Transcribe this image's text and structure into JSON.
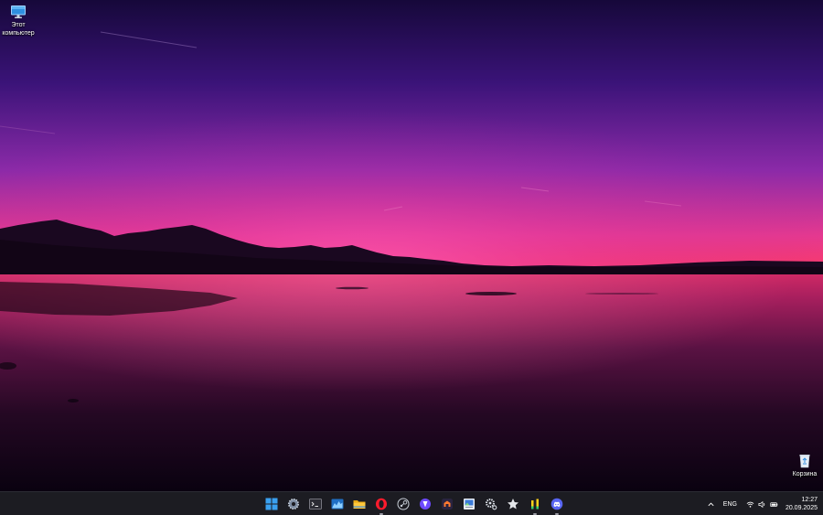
{
  "desktop": {
    "icons": [
      {
        "label": "Этот компьютер",
        "icon": "monitor-icon"
      },
      {
        "label": "Корзина",
        "icon": "recycle-bin-icon"
      }
    ]
  },
  "taskbar": {
    "apps": [
      {
        "name": "Start",
        "icon": "windows-start-icon",
        "running": false
      },
      {
        "name": "Settings",
        "icon": "settings-gear-icon",
        "running": false
      },
      {
        "name": "Terminal",
        "icon": "terminal-icon",
        "running": false
      },
      {
        "name": "Task Manager",
        "icon": "task-manager-icon",
        "running": false
      },
      {
        "name": "File Explorer",
        "icon": "folder-icon",
        "running": false
      },
      {
        "name": "Opera",
        "icon": "opera-icon",
        "running": true
      },
      {
        "name": "Steam",
        "icon": "steam-icon",
        "running": false
      },
      {
        "name": "Proton VPN",
        "icon": "vpn-icon",
        "running": false
      },
      {
        "name": "Launcher",
        "icon": "launcher-icon",
        "running": false
      },
      {
        "name": "Photos",
        "icon": "photo-viewer-icon",
        "running": false
      },
      {
        "name": "Settings",
        "icon": "cog-icon",
        "running": false
      },
      {
        "name": "Favorites",
        "icon": "star-icon",
        "running": false
      },
      {
        "name": "Audio",
        "icon": "audio-meter-icon",
        "running": true
      },
      {
        "name": "Discord",
        "icon": "discord-icon",
        "running": true
      }
    ],
    "tray": {
      "language": "ENG",
      "time": "12:27",
      "date": "20.09.2025"
    }
  },
  "colors": {
    "taskbar_bg": "#1c1c22",
    "sky_top": "#1a0b43",
    "sky_mid": "#6e1d9e",
    "horizon_glow": "#ff3d7d",
    "water_dark": "#0c0210"
  }
}
